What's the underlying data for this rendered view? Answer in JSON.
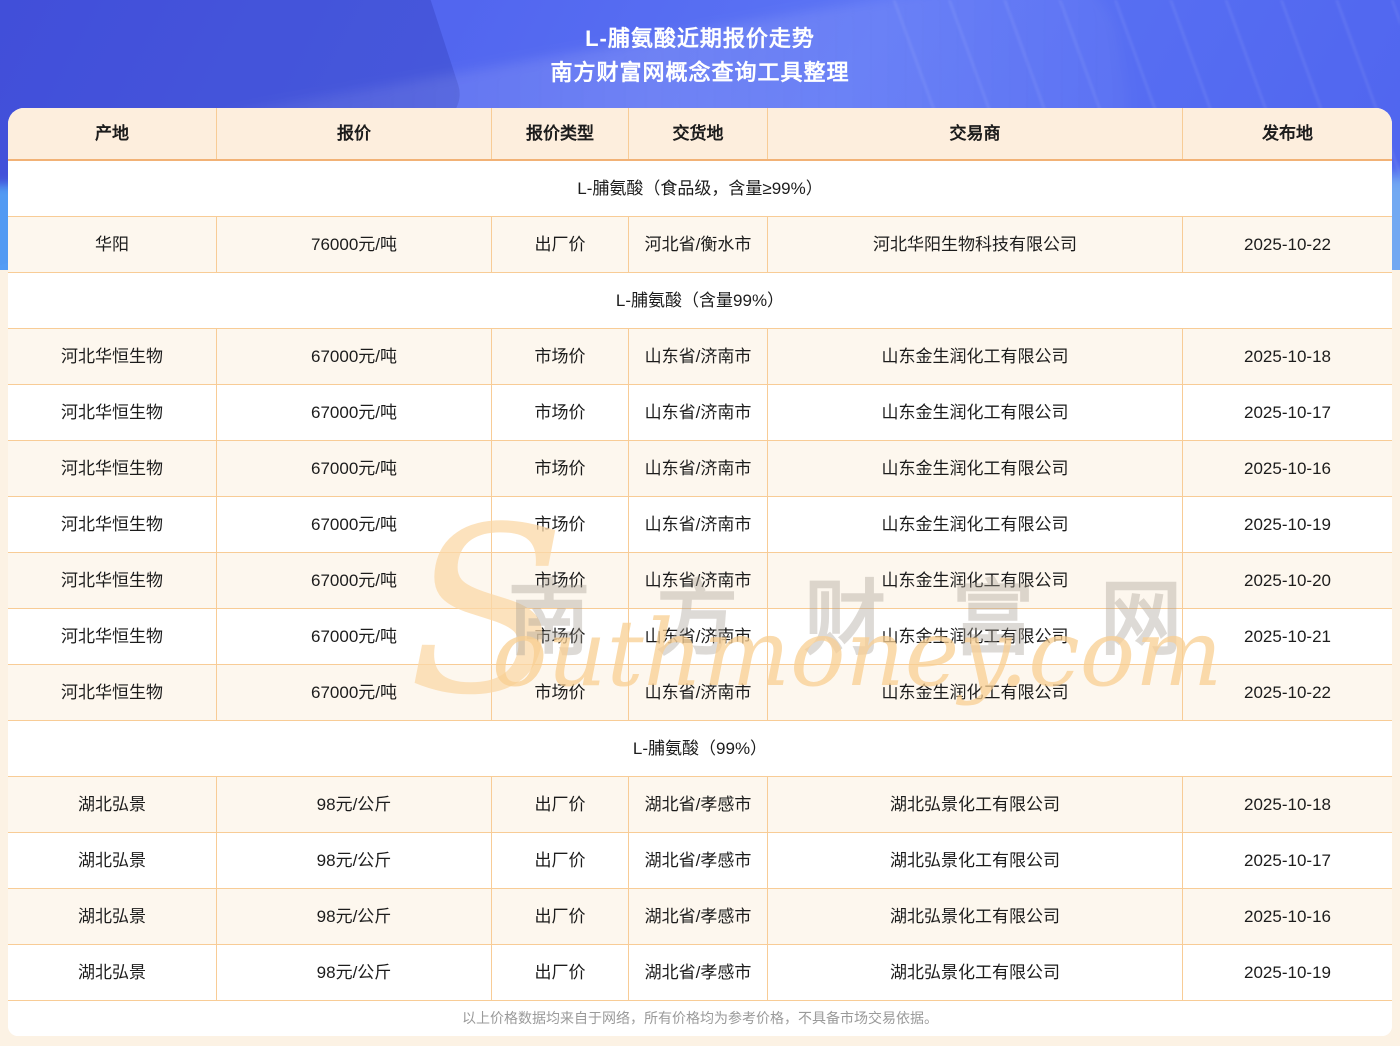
{
  "page": {
    "title_line1": "L-脯氨酸近期报价走势",
    "title_line2": "南方财富网概念查询工具整理"
  },
  "colors": {
    "banner_blue": "#5266ef",
    "header_bg": "#fdeedd",
    "row_tint": "#fdf7ee",
    "grid_border": "#f8cc96",
    "header_border": "#f2b276",
    "page_bg": "#fcf2e4",
    "note_gray": "#9a9a9a"
  },
  "table": {
    "headers": [
      "产地",
      "报价",
      "报价类型",
      "交货地",
      "交易商",
      "发布地"
    ],
    "rows": [
      {
        "type": "section",
        "label": "L-脯氨酸（食品级，含量≥99%）"
      },
      {
        "type": "data",
        "origin": "华阳",
        "price": "76000元/吨",
        "price_type": "出厂价",
        "delivery": "河北省/衡水市",
        "trader": "河北华阳生物科技有限公司",
        "date": "2025-10-22"
      },
      {
        "type": "section",
        "label": "L-脯氨酸（含量99%）"
      },
      {
        "type": "data",
        "origin": "河北华恒生物",
        "price": "67000元/吨",
        "price_type": "市场价",
        "delivery": "山东省/济南市",
        "trader": "山东金生润化工有限公司",
        "date": "2025-10-18"
      },
      {
        "type": "data",
        "origin": "河北华恒生物",
        "price": "67000元/吨",
        "price_type": "市场价",
        "delivery": "山东省/济南市",
        "trader": "山东金生润化工有限公司",
        "date": "2025-10-17"
      },
      {
        "type": "data",
        "origin": "河北华恒生物",
        "price": "67000元/吨",
        "price_type": "市场价",
        "delivery": "山东省/济南市",
        "trader": "山东金生润化工有限公司",
        "date": "2025-10-16"
      },
      {
        "type": "data",
        "origin": "河北华恒生物",
        "price": "67000元/吨",
        "price_type": "市场价",
        "delivery": "山东省/济南市",
        "trader": "山东金生润化工有限公司",
        "date": "2025-10-19"
      },
      {
        "type": "data",
        "origin": "河北华恒生物",
        "price": "67000元/吨",
        "price_type": "市场价",
        "delivery": "山东省/济南市",
        "trader": "山东金生润化工有限公司",
        "date": "2025-10-20"
      },
      {
        "type": "data",
        "origin": "河北华恒生物",
        "price": "67000元/吨",
        "price_type": "市场价",
        "delivery": "山东省/济南市",
        "trader": "山东金生润化工有限公司",
        "date": "2025-10-21"
      },
      {
        "type": "data",
        "origin": "河北华恒生物",
        "price": "67000元/吨",
        "price_type": "市场价",
        "delivery": "山东省/济南市",
        "trader": "山东金生润化工有限公司",
        "date": "2025-10-22"
      },
      {
        "type": "section",
        "label": "L-脯氨酸（99%）"
      },
      {
        "type": "data",
        "origin": "湖北弘景",
        "price": "98元/公斤",
        "price_type": "出厂价",
        "delivery": "湖北省/孝感市",
        "trader": "湖北弘景化工有限公司",
        "date": "2025-10-18"
      },
      {
        "type": "data",
        "origin": "湖北弘景",
        "price": "98元/公斤",
        "price_type": "出厂价",
        "delivery": "湖北省/孝感市",
        "trader": "湖北弘景化工有限公司",
        "date": "2025-10-17"
      },
      {
        "type": "data",
        "origin": "湖北弘景",
        "price": "98元/公斤",
        "price_type": "出厂价",
        "delivery": "湖北省/孝感市",
        "trader": "湖北弘景化工有限公司",
        "date": "2025-10-16"
      },
      {
        "type": "data",
        "origin": "湖北弘景",
        "price": "98元/公斤",
        "price_type": "出厂价",
        "delivery": "湖北省/孝感市",
        "trader": "湖北弘景化工有限公司",
        "date": "2025-10-19"
      }
    ],
    "footer_note": "以上价格数据均来自于网络，所有价格均为参考价格，不具备市场交易依据。"
  },
  "watermark": {
    "initial": "S",
    "cn": "南方财富网",
    "en": "outhmoney.com"
  }
}
